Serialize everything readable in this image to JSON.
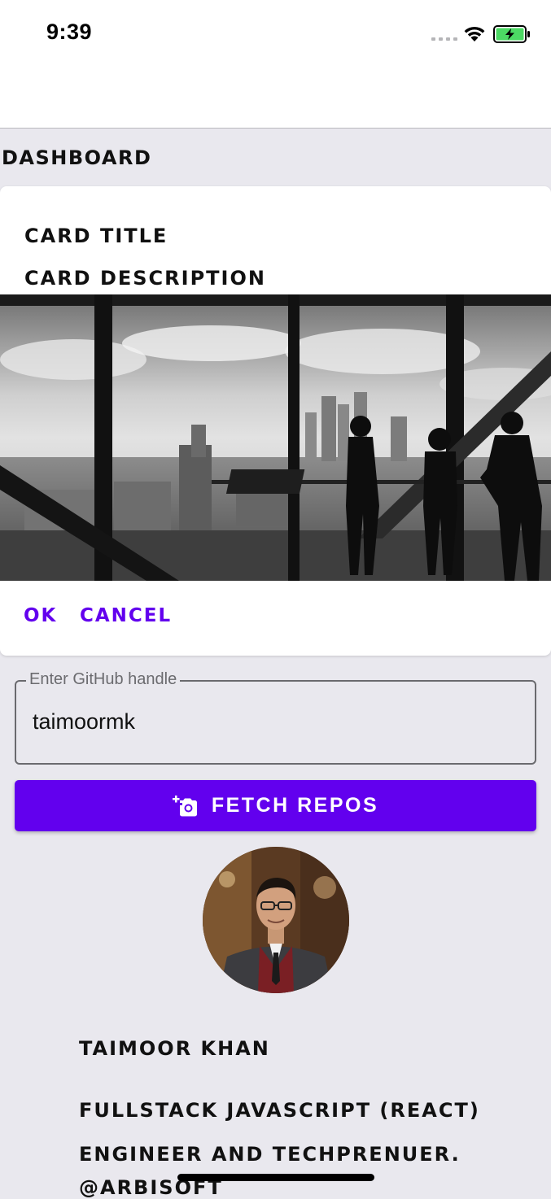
{
  "status_bar": {
    "time": "9:39",
    "icons": [
      "cellular-signal-icon",
      "wifi-icon",
      "battery-charging-icon"
    ]
  },
  "dashboard": {
    "title": "DASHBOARD"
  },
  "card": {
    "title": "CARD TITLE",
    "description": "CARD DESCRIPTION",
    "image": "city-skyline-photo",
    "actions": {
      "ok_label": "OK",
      "cancel_label": "CANCEL"
    }
  },
  "github_form": {
    "label": "Enter GitHub handle",
    "value": "taimoormk",
    "button_label": "FETCH REPOS",
    "button_icon": "add-a-photo-icon"
  },
  "profile": {
    "avatar": "profile-photo",
    "name": "TAIMOOR KHAN",
    "bio": "FULLSTACK JAVASCRIPT (REACT) ENGINEER AND TECHPRENUER.",
    "company": "@ARBISOFT"
  },
  "colors": {
    "primary": "#6200ee",
    "background": "#e9e8ee",
    "surface": "#ffffff",
    "battery": "#4cd964"
  }
}
